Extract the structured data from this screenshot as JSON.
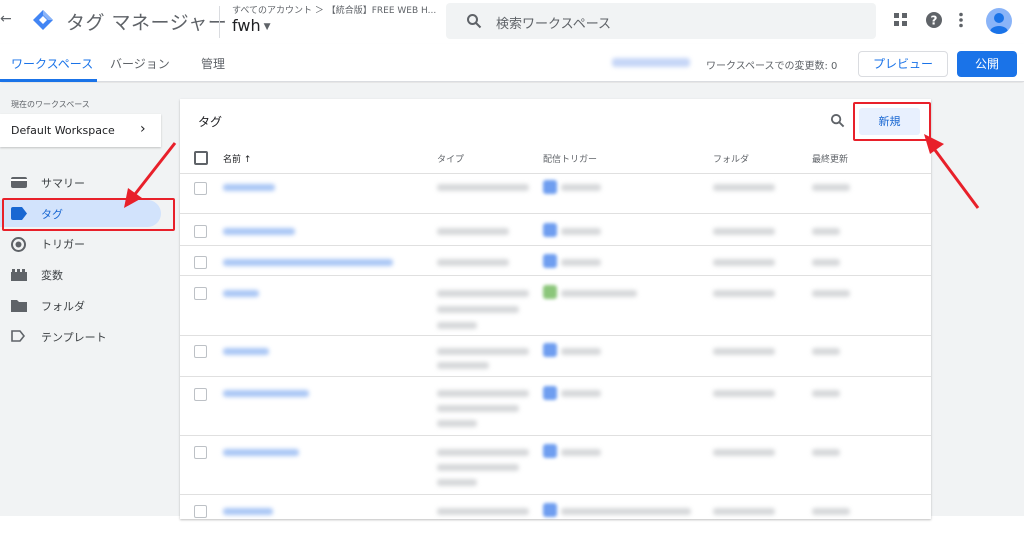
{
  "header": {
    "back_glyph": "←",
    "app_title": "タグ マネージャー",
    "breadcrumb": "すべてのアカウント ＞ 【統合版】FREE WEB H...",
    "container_name": "fwh",
    "search_placeholder": "検索ワークスペース",
    "icons": [
      "back-arrow-icon",
      "gtm-logo-icon",
      "search-icon",
      "apps-grid-icon",
      "help-icon",
      "more-vert-icon",
      "account-avatar-icon"
    ]
  },
  "tabs": {
    "workspace": "ワークスペース",
    "versions": "バージョン",
    "admin": "管理",
    "variable_count": "ワークスペースでの変更数: 0",
    "preview": "プレビュー",
    "publish": "公開"
  },
  "sidebar": {
    "current_workspace_label": "現在のワークスペース",
    "workspace_name": "Default Workspace",
    "items": [
      {
        "label": "サマリー",
        "icon": "summary-icon"
      },
      {
        "label": "タグ",
        "icon": "tag-icon",
        "active": true
      },
      {
        "label": "トリガー",
        "icon": "trigger-icon"
      },
      {
        "label": "変数",
        "icon": "variables-icon"
      },
      {
        "label": "フォルダ",
        "icon": "folder-icon"
      },
      {
        "label": "テンプレート",
        "icon": "template-icon"
      }
    ]
  },
  "panel": {
    "title": "タグ",
    "new_button": "新規",
    "columns": {
      "name": "名前",
      "sort_glyph": "↑",
      "type": "タイプ",
      "trigger": "配信トリガー",
      "folder": "フォルダ",
      "modified": "最終更新"
    }
  },
  "colors": {
    "accent": "#1a73e8",
    "active_nav_bg": "#d2e3fc",
    "annotation_red": "#e8202a"
  }
}
